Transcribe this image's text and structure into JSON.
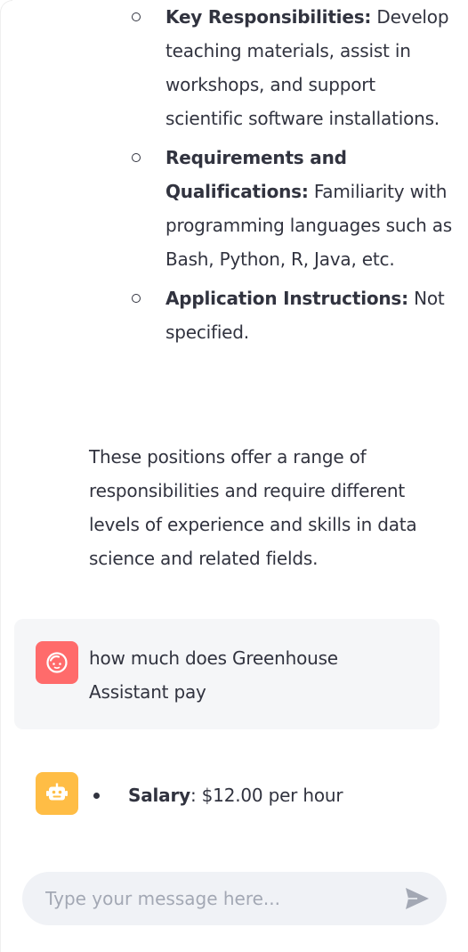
{
  "previous_reply": {
    "sub_items": [
      {
        "label": "Key Responsibilities:",
        "text": "Develop teaching materials, assist in workshops, and support scientific software installations."
      },
      {
        "label": "Requirements and Qualifications:",
        "text": "Familiarity with programming languages such as Bash, Python, R, Java, etc."
      },
      {
        "label": "Application Instructions:",
        "text": "Not specified."
      }
    ],
    "summary": "These positions offer a range of responsibilities and require different levels of experience and skills in data science and related fields."
  },
  "user_message": {
    "avatar_icon": "face-icon",
    "avatar_color": "#ff6b6b",
    "text": "how much does Greenhouse Assistant pay"
  },
  "assistant_message": {
    "avatar_icon": "robot-icon",
    "avatar_color": "#ffbd45",
    "items": [
      {
        "label": "Salary",
        "text": ": $12.00 per hour"
      }
    ]
  },
  "chat_input": {
    "placeholder": "Type your message here...",
    "value": "",
    "send_icon": "send-icon"
  }
}
